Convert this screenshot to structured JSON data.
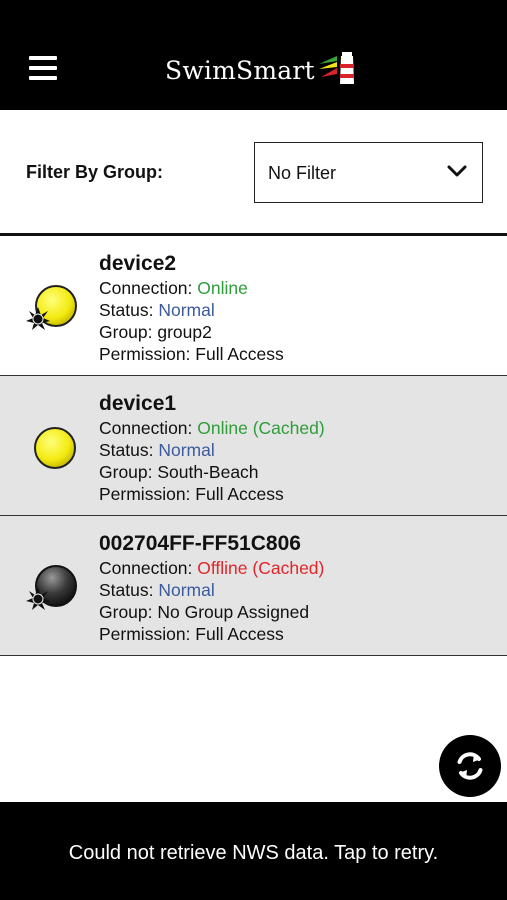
{
  "header": {
    "menu_icon": "hamburger-menu-icon",
    "brand_name": "SwimSmart",
    "logo_icon": "swimsmart-lighthouse-logo",
    "colors": {
      "background": "#000000",
      "logo_green": "#3aa635",
      "logo_yellow": "#f2e31b",
      "logo_red": "#d9232a"
    }
  },
  "filter": {
    "label": "Filter By Group:",
    "selected": "No Filter",
    "chevron_icon": "chevron-down-icon"
  },
  "devices": [
    {
      "name": "device2",
      "connection_label": "Connection: ",
      "connection_value": "Online",
      "status_label": "Status: ",
      "status_value": "Normal",
      "group_text": "Group: group2",
      "permission_text": "Permission: Full Access",
      "icon": "yellow-light-with-burst-icon"
    },
    {
      "name": "device1",
      "connection_label": "Connection: ",
      "connection_value": "Online (Cached)",
      "status_label": "Status: ",
      "status_value": "Normal",
      "group_text": "Group: South-Beach",
      "permission_text": "Permission: Full Access",
      "icon": "yellow-light-icon"
    },
    {
      "name": "002704FF-FF51C806",
      "connection_label": "Connection: ",
      "connection_value": "Offline (Cached)",
      "status_label": "Status: ",
      "status_value": "Normal",
      "group_text": "Group: No Group Assigned",
      "permission_text": "Permission: Full Access",
      "icon": "dark-light-with-burst-icon"
    }
  ],
  "colors": {
    "online": "#2f9d3a",
    "offline": "#e0262a",
    "status_normal": "#3c5b9c",
    "row_alt_bg": "#e4e4e4"
  },
  "refresh": {
    "icon": "refresh-icon"
  },
  "footer": {
    "message": "Could not retrieve NWS data. Tap to retry."
  }
}
